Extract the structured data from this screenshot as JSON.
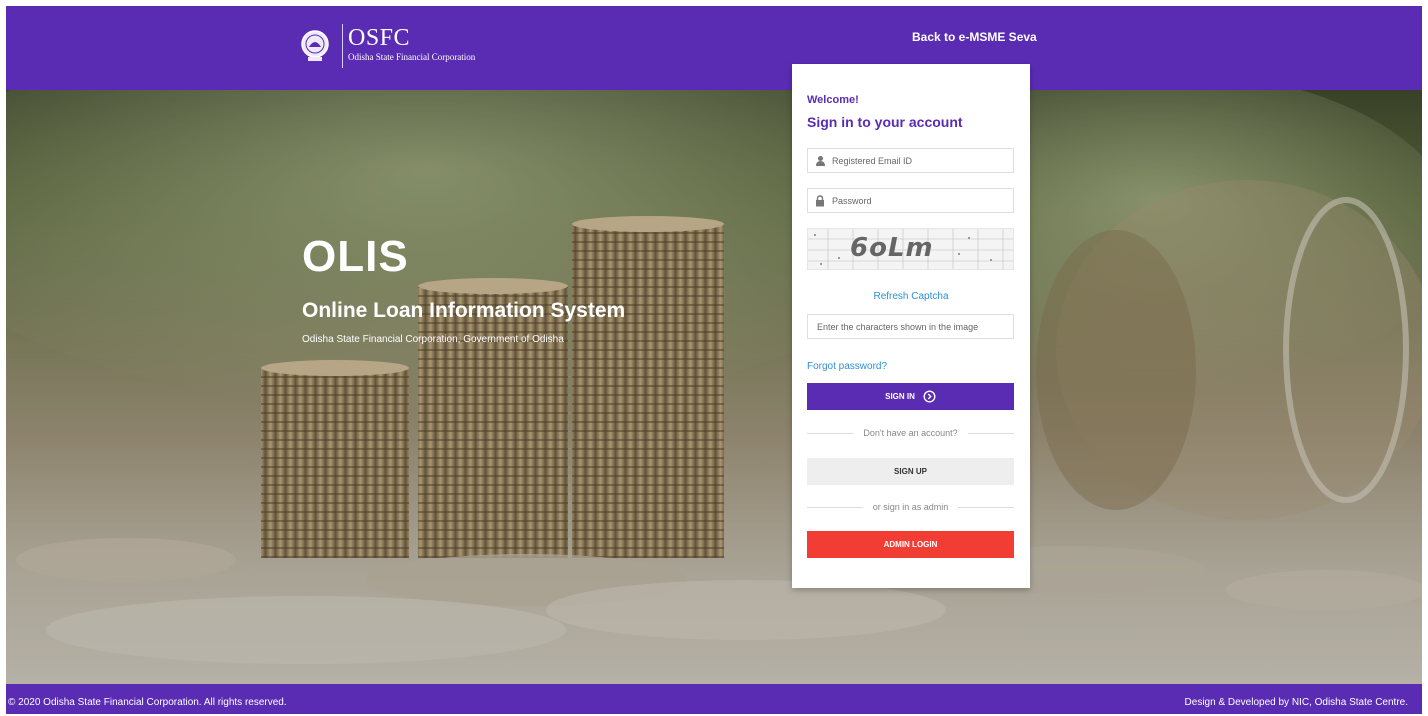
{
  "header": {
    "brand": "OSFC",
    "brand_sub": "Odisha State Financial Corporation",
    "back_link": "Back to e-MSME Seva"
  },
  "hero": {
    "title": "OLIS",
    "subtitle": "Online Loan Information System",
    "caption": "Odisha State Financial Corporation, Government of Odisha"
  },
  "login": {
    "welcome": "Welcome!",
    "title": "Sign in to your account",
    "email_placeholder": "Registered Email ID",
    "password_placeholder": "Password",
    "captcha_text": "6oLm",
    "refresh_captcha": "Refresh Captcha",
    "captcha_placeholder": "Enter the characters shown in the image",
    "forgot_password": "Forgot password?",
    "signin_button": "SIGN IN",
    "no_account": "Don't have an account?",
    "signup_button": "SIGN UP",
    "admin_divider": "or sign in as admin",
    "admin_button": "ADMIN LOGIN"
  },
  "footer": {
    "copyright": "© 2020 Odisha State Financial Corporation. All rights reserved.",
    "credits": "Design & Developed by NIC, Odisha State Centre."
  },
  "colors": {
    "brand_purple": "#5a2cb3",
    "link_blue": "#2f8fd6",
    "admin_red": "#f23d35"
  },
  "icons": [
    "emblem-icon",
    "user-icon",
    "lock-icon",
    "arrow-circle-right-icon"
  ]
}
